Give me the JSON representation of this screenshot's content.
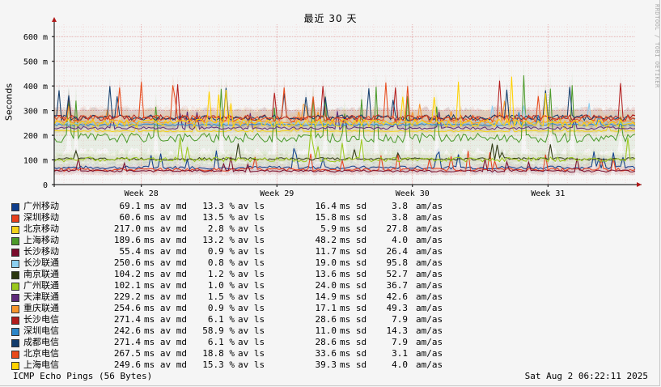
{
  "title": "最近 30 天",
  "vertical_note": "RRDTOOL / TOBI OETIKER",
  "footer": {
    "left": "ICMP Echo Pings (56 Bytes)",
    "right": "Sat Aug  2 06:22:11 2025"
  },
  "chart_data": {
    "type": "line",
    "title": "最近 30 天",
    "ylabel": "Seconds",
    "ylim": [
      0,
      650
    ],
    "yticks": [
      {
        "value": 0,
        "label": "0"
      },
      {
        "value": 100,
        "label": "100 m"
      },
      {
        "value": 200,
        "label": "200 m"
      },
      {
        "value": 300,
        "label": "300 m"
      },
      {
        "value": 400,
        "label": "400 m"
      },
      {
        "value": 500,
        "label": "500 m"
      },
      {
        "value": 600,
        "label": "600 m"
      }
    ],
    "xticks": [
      {
        "position_day": 4.5,
        "label": "Week 28"
      },
      {
        "position_day": 11.5,
        "label": "Week 29"
      },
      {
        "position_day": 18.5,
        "label": "Week 30"
      },
      {
        "position_day": 25.5,
        "label": "Week 31"
      }
    ],
    "x_days": 30,
    "grid": true,
    "series": [
      {
        "name": "广州移动",
        "color": "#0f3e8c",
        "median": 69.1,
        "loss": "13.3 %",
        "loss_label": "av ls",
        "sd": 16.4,
        "amas": 3.8
      },
      {
        "name": "深圳移动",
        "color": "#e8401c",
        "median": 60.6,
        "loss": "13.5 %",
        "loss_label": "av ls",
        "sd": 15.8,
        "amas": 3.8
      },
      {
        "name": "北京移动",
        "color": "#f4d21c",
        "median": 217.0,
        "loss": "2.8 %",
        "loss_label": "av ls",
        "sd": 5.9,
        "amas": 27.8
      },
      {
        "name": "上海移动",
        "color": "#4c9a2a",
        "median": 189.6,
        "loss": "13.2 %",
        "loss_label": "av ls",
        "sd": 48.2,
        "amas": 4.0
      },
      {
        "name": "长沙移动",
        "color": "#7a0c2c",
        "median": 55.4,
        "loss": "0.9 %",
        "loss_label": "av ls",
        "sd": 11.7,
        "amas": 26.4
      },
      {
        "name": "长沙联通",
        "color": "#8ccff0",
        "median": 250.6,
        "loss": "0.8 %",
        "loss_label": "av ls",
        "sd": 19.0,
        "amas": 95.8
      },
      {
        "name": "南京联通",
        "color": "#2b3610",
        "median": 104.2,
        "loss": "1.2 %",
        "loss_label": "av ls",
        "sd": 13.6,
        "amas": 52.7
      },
      {
        "name": "广州联通",
        "color": "#9ac81c",
        "median": 102.1,
        "loss": "1.0 %",
        "loss_label": "av ls",
        "sd": 24.0,
        "amas": 36.7
      },
      {
        "name": "天津联通",
        "color": "#5e2a7a",
        "median": 229.2,
        "loss": "1.5 %",
        "loss_label": "av ls",
        "sd": 14.9,
        "amas": 42.6
      },
      {
        "name": "重庆联通",
        "color": "#f8962c",
        "median": 254.6,
        "loss": "0.9 %",
        "loss_label": "av ls",
        "sd": 17.1,
        "amas": 49.3
      },
      {
        "name": "长沙电信",
        "color": "#b21c1c",
        "median": 271.4,
        "loss": "6.1 %",
        "loss_label": "av ls",
        "sd": 28.6,
        "amas": 7.9
      },
      {
        "name": "深圳电信",
        "color": "#2c86c8",
        "median": 242.6,
        "loss": "58.9 %",
        "loss_label": "av ls",
        "sd": 11.0,
        "amas": 14.3
      },
      {
        "name": "成都电信",
        "color": "#123c6c",
        "median": 271.4,
        "loss": "6.1 %",
        "loss_label": "av ls",
        "sd": 28.6,
        "amas": 7.9
      },
      {
        "name": "北京电信",
        "color": "#e84a1a",
        "median": 267.5,
        "loss": "18.8 %",
        "loss_label": "av ls",
        "sd": 33.6,
        "amas": 3.1
      },
      {
        "name": "上海电信",
        "color": "#ffd200",
        "median": 249.6,
        "loss": "15.3 %",
        "loss_label": "av ls",
        "sd": 39.3,
        "amas": 4.0
      }
    ],
    "units": {
      "median": "ms av md",
      "sd": "ms sd",
      "amas": "am/as"
    }
  }
}
